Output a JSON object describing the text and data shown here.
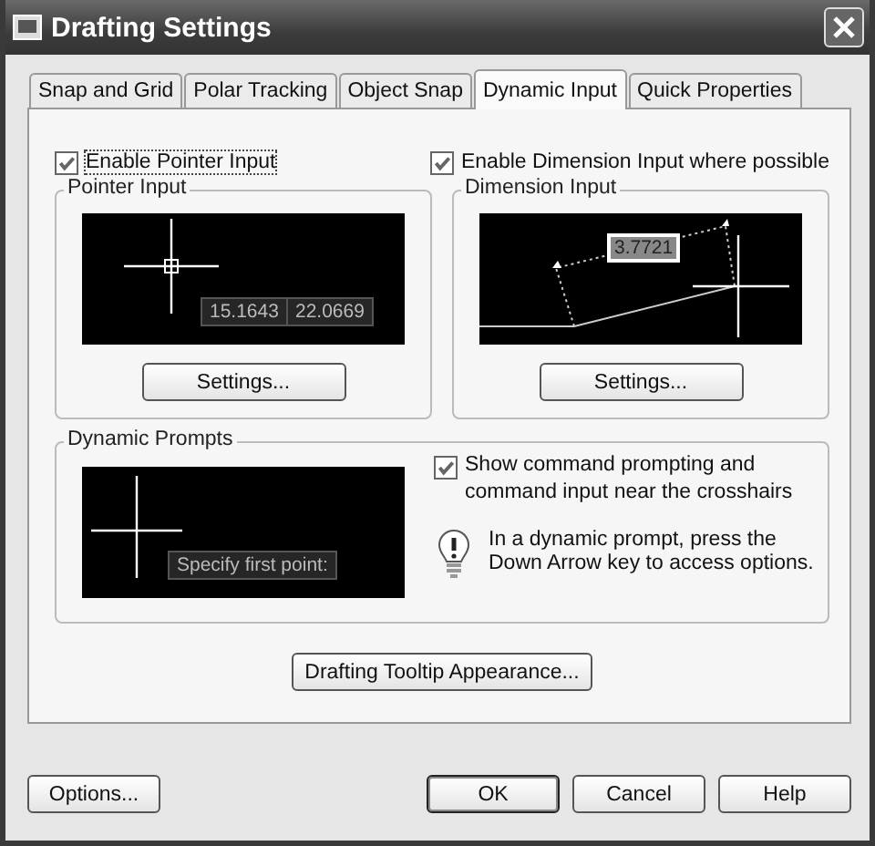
{
  "window": {
    "title": "Drafting Settings"
  },
  "tabs": [
    {
      "label": "Snap and Grid",
      "selected": false
    },
    {
      "label": "Polar Tracking",
      "selected": false
    },
    {
      "label": "Object Snap",
      "selected": false
    },
    {
      "label": "Dynamic Input",
      "selected": true
    },
    {
      "label": "Quick Properties",
      "selected": false
    }
  ],
  "enable_pointer_input": {
    "label": "Enable Pointer Input",
    "checked": true
  },
  "enable_dimension_input": {
    "label": "Enable Dimension Input where possible",
    "checked": true
  },
  "pointer_input": {
    "title": "Pointer Input",
    "x_value": "15.1643",
    "y_value": "22.0669",
    "button": "Settings..."
  },
  "dimension_input": {
    "title": "Dimension Input",
    "value": "3.7721",
    "button": "Settings..."
  },
  "dynamic_prompts": {
    "title": "Dynamic Prompts",
    "prompt": "Specify first point:",
    "show_prompting": {
      "label": "Show command prompting and command input near the crosshairs",
      "checked": true
    },
    "tip": "In a dynamic prompt, press the Down Arrow key to access options."
  },
  "tooltip_button": "Drafting Tooltip Appearance...",
  "buttons": {
    "options": "Options...",
    "ok": "OK",
    "cancel": "Cancel",
    "help": "Help"
  }
}
